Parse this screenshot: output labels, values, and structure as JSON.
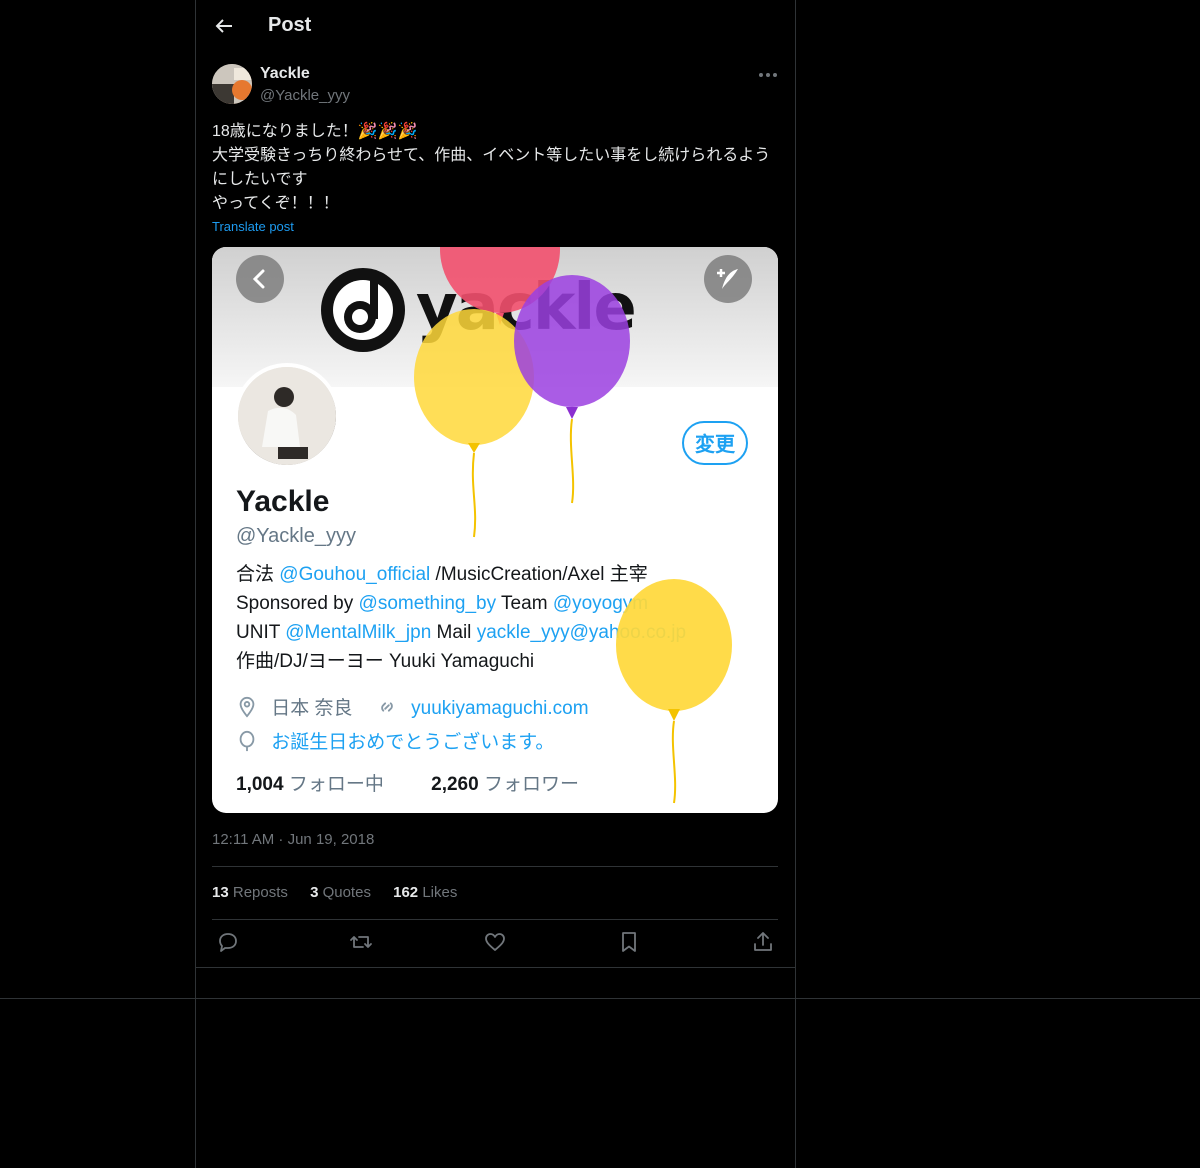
{
  "header": {
    "title": "Post"
  },
  "post": {
    "author_name": "Yackle",
    "author_handle": "@Yackle_yyy",
    "text": "18歳になりました！🎉🎉🎉\n大学受験きっちり終わらせて、作曲、イベント等したい事をし続けられるようにしたいです\nやってくぞ！！！",
    "translate_label": "Translate post",
    "timestamp": "12:11 AM · Jun 19, 2018",
    "stats": {
      "reposts_count": "13",
      "reposts_label": "Reposts",
      "quotes_count": "3",
      "quotes_label": "Quotes",
      "likes_count": "162",
      "likes_label": "Likes"
    }
  },
  "media": {
    "logo_text": "yackle",
    "profile_name": "Yackle",
    "profile_handle": "@Yackle_yyy",
    "edit_label": "変更",
    "bio": {
      "l1a": "合法 ",
      "l1m": "@Gouhou_official",
      "l1b": " /MusicCreation/Axel 主宰",
      "l2a": "Sponsored by ",
      "l2m": "@something_by",
      "l2b": " Team ",
      "l2m2": "@yoyogym",
      "l3a": "UNIT ",
      "l3m": "@MentalMilk_jpn",
      "l3b": " Mail ",
      "l3m2": "yackle_yyy@yahoo.co.jp",
      "l4": "作曲/DJ/ヨーヨー Yuuki Yamaguchi"
    },
    "location": "日本 奈良",
    "website": "yuukiyamaguchi.com",
    "birthday_message": "お誕生日おめでとうございます。",
    "following_count": "1,004",
    "following_label": "フォロー中",
    "followers_count": "2,260",
    "followers_label": "フォロワー"
  },
  "colors": {
    "accent": "#1d9bf0",
    "balloon_red": "#f2506e",
    "balloon_purple": "#9b3fe0",
    "balloon_yellow": "#ffd83a"
  },
  "icons": [
    "back-arrow-icon",
    "more-icon",
    "reply-icon",
    "repost-icon",
    "like-icon",
    "bookmark-icon",
    "share-icon",
    "location-icon",
    "link-icon",
    "balloon-icon",
    "chevron-left-icon",
    "feather-plus-icon"
  ]
}
